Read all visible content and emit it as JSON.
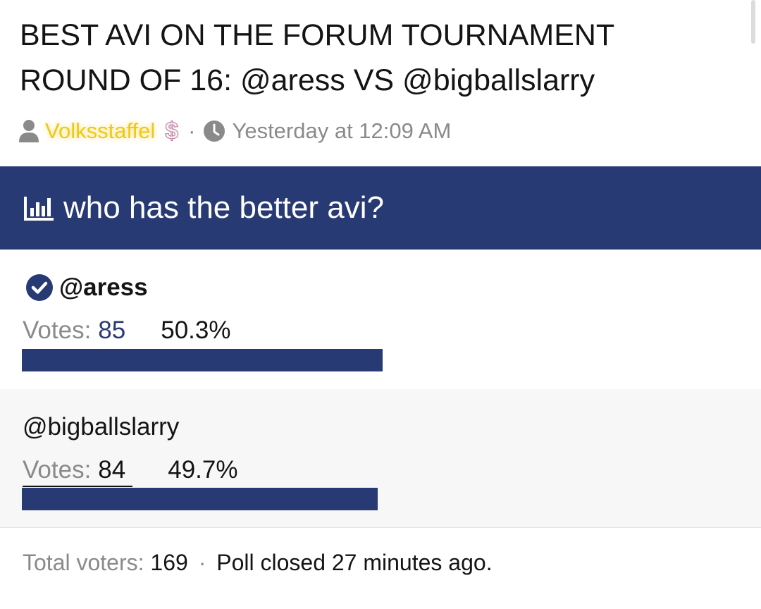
{
  "thread": {
    "title": "BEST AVI ON THE FORUM TOURNAMENT ROUND OF 16: @aress VS @bigballslarry",
    "author": "Volksstaffel",
    "posted": "Yesterday at 12:09 AM",
    "meta_separator": "·",
    "author_badge_icon": "dollar-sign-icon",
    "author_color": "#f2c811"
  },
  "poll": {
    "question": "who has the better avi?",
    "header_color": "#283a73",
    "options": [
      {
        "label": "@aress",
        "voted": true,
        "votes_label": "Votes:",
        "votes": "85",
        "percent_text": "50.3%",
        "fill_fraction": 0.503
      },
      {
        "label": "@bigballslarry",
        "voted": false,
        "votes_label": "Votes:",
        "votes": "84",
        "percent_text": "49.7%",
        "fill_fraction": 0.497
      }
    ],
    "footer": {
      "total_label": "Total voters:",
      "total_value": "169",
      "separator": "·",
      "closed_text": "Poll closed 27 minutes ago."
    }
  }
}
